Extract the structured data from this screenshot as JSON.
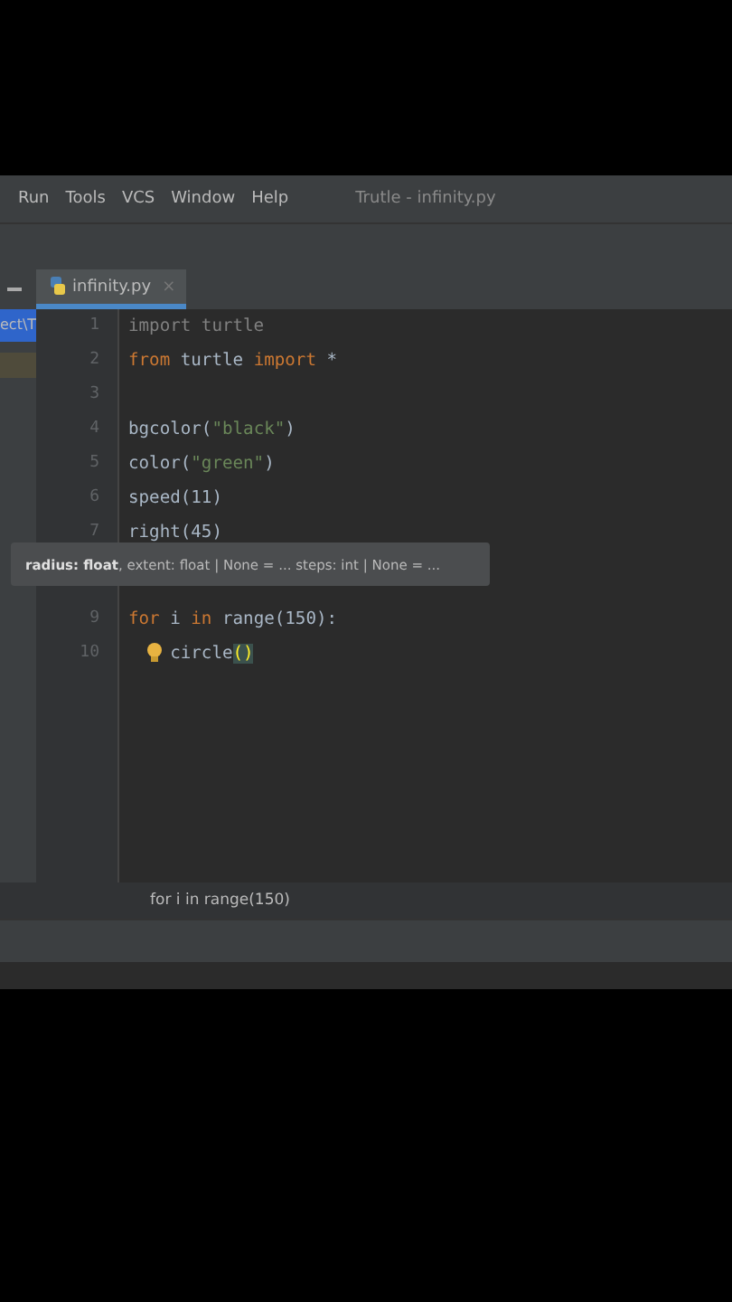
{
  "menu": [
    "Run",
    "Tools",
    "VCS",
    "Window",
    "Help"
  ],
  "window": {
    "title": "Trutle - infinity.py"
  },
  "tabs": [
    {
      "label": "infinity.py",
      "selected": true,
      "close": "×"
    }
  ],
  "project_panel": {
    "path": "ect\\T"
  },
  "editor": {
    "lines": [
      {
        "number": "1",
        "tokens": [
          {
            "text": "import turtle",
            "kind": "unused"
          }
        ]
      },
      {
        "number": "2",
        "tokens": [
          {
            "text": "from",
            "kind": "keyword"
          },
          {
            "text": " turtle ",
            "kind": "plain"
          },
          {
            "text": "import",
            "kind": "keyword"
          },
          {
            "text": " *",
            "kind": "plain"
          }
        ]
      },
      {
        "number": "3"
      },
      {
        "number": "4",
        "tokens": [
          {
            "text": "bgcolor(",
            "kind": "plain"
          },
          {
            "text": "\"black\"",
            "kind": "string"
          },
          {
            "text": ")",
            "kind": "plain"
          }
        ]
      },
      {
        "number": "5",
        "tokens": [
          {
            "text": "color(",
            "kind": "plain"
          },
          {
            "text": "\"green\"",
            "kind": "string"
          },
          {
            "text": ")",
            "kind": "plain"
          }
        ]
      },
      {
        "number": "6",
        "tokens": [
          {
            "text": "speed(11)",
            "kind": "plain"
          }
        ]
      },
      {
        "number": "7",
        "tokens": [
          {
            "text": "right(45)",
            "kind": "plain"
          }
        ]
      },
      {
        "number": "9",
        "tokens": [
          {
            "text": "for",
            "kind": "keyword"
          },
          {
            "text": " i ",
            "kind": "plain"
          },
          {
            "text": "in",
            "kind": "keyword"
          },
          {
            "text": " range(150):",
            "kind": "plain"
          }
        ]
      },
      {
        "number": "10",
        "bulb": true,
        "tokens": [
          {
            "text": "    circle",
            "kind": "plain"
          },
          {
            "text": "()",
            "kind": "bracket_match"
          }
        ]
      }
    ]
  },
  "tooltip": {
    "text": "**radius: float**, extent: float | None = ... steps: int | None = ..."
  },
  "breadcrumb": "for i in range(150)"
}
